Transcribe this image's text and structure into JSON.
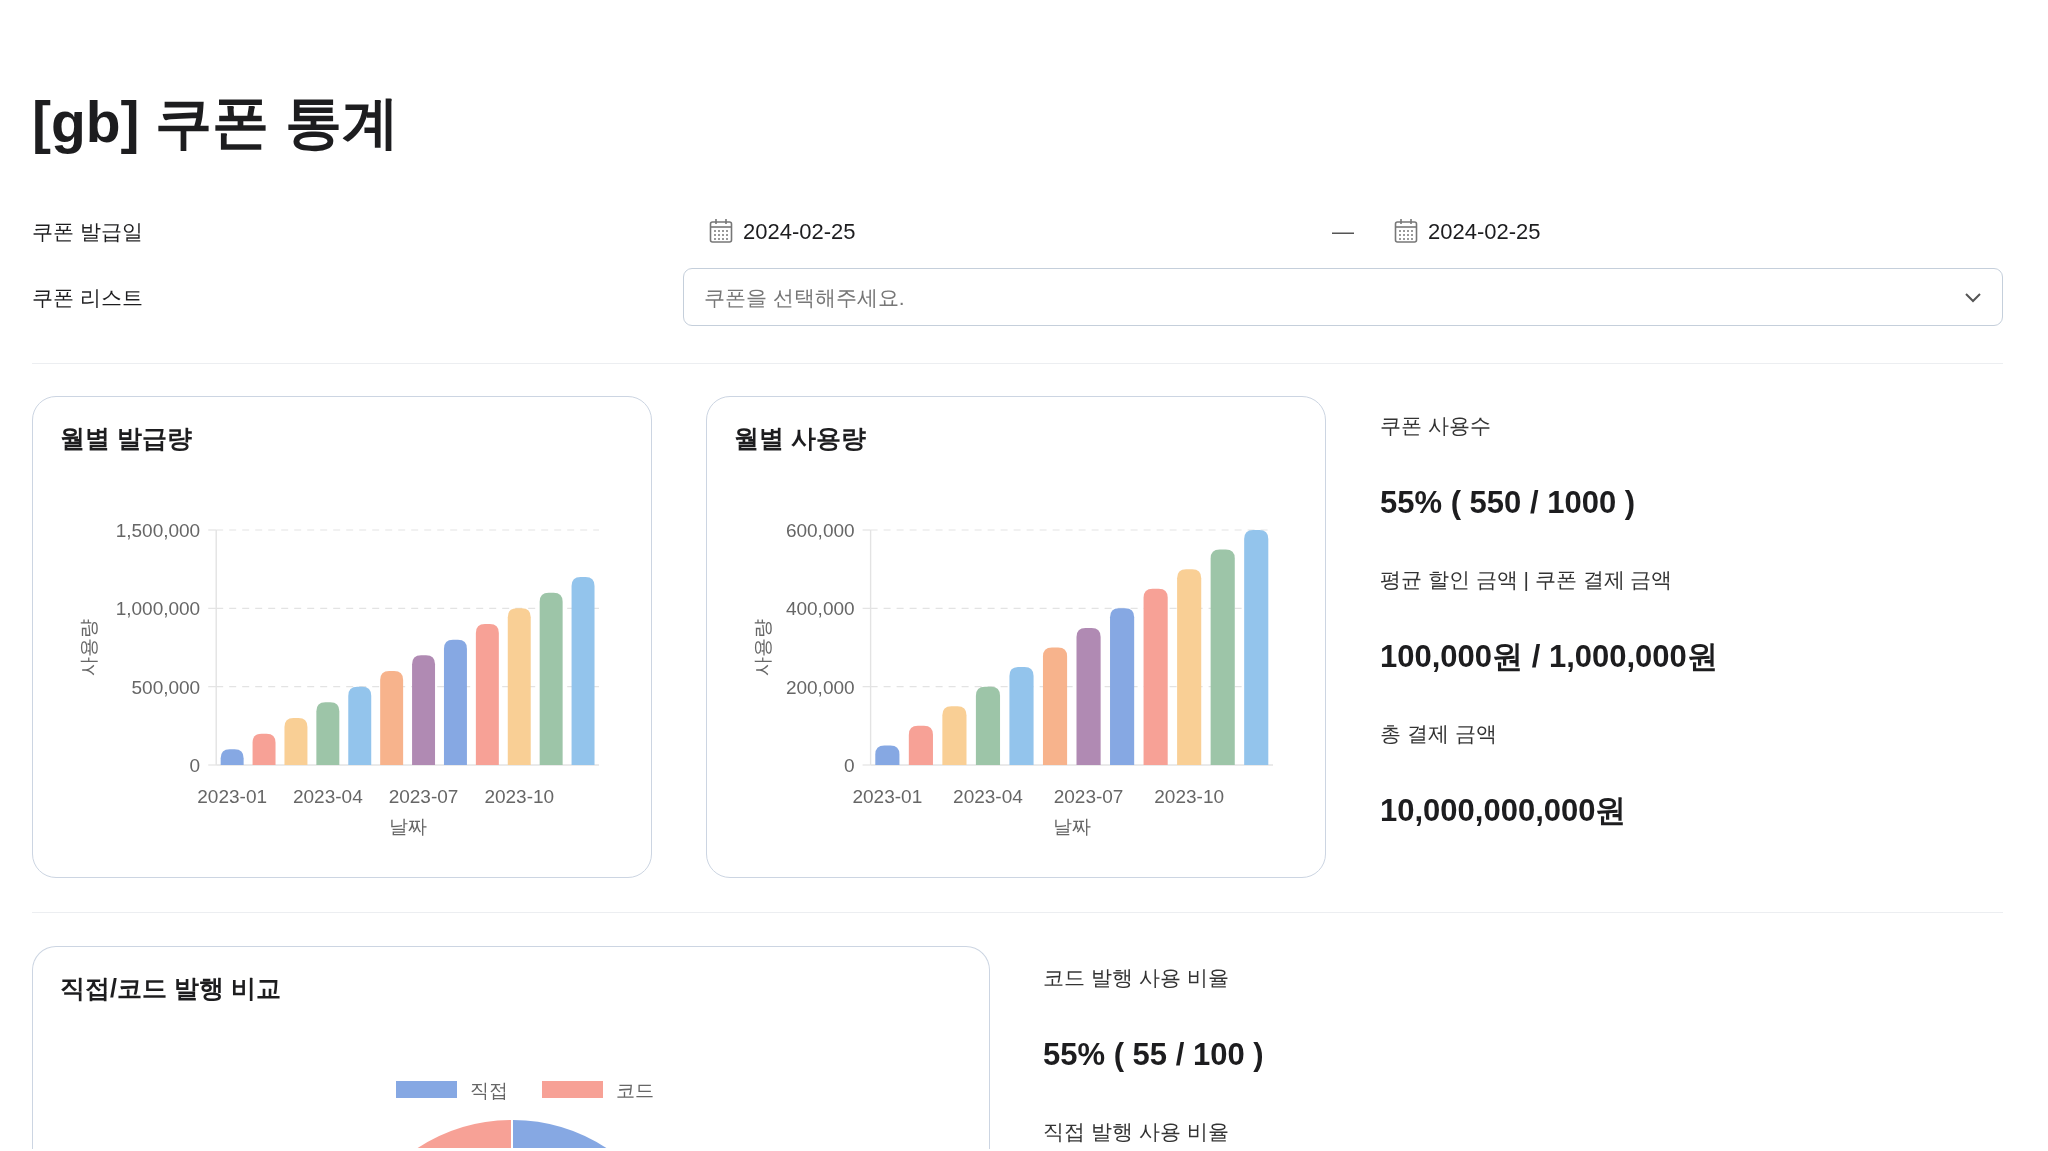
{
  "title": "[gb] 쿠폰 통계",
  "filters": [
    {
      "kind": "date_range",
      "label": "쿠폰 발급일",
      "start": "2024-02-25",
      "separator": "—",
      "end": "2024-02-25"
    },
    {
      "kind": "select",
      "label": "쿠폰 리스트",
      "placeholder": "쿠폰을 선택해주세요."
    }
  ],
  "chart_cards": [
    {
      "title": "월별 발급량",
      "chart_data": {
        "type": "bar",
        "xlabel": "날짜",
        "ylabel": "사용량",
        "categories": [
          "2023-01",
          null,
          null,
          "2023-04",
          null,
          null,
          "2023-07",
          null,
          null,
          "2023-10",
          null,
          null
        ],
        "values": [
          100000,
          200000,
          300000,
          400000,
          500000,
          600000,
          700000,
          800000,
          900000,
          1000000,
          1100000,
          1200000
        ],
        "colors": [
          "#86a8e3",
          "#f7a196",
          "#f9cf95",
          "#9dc5a8",
          "#93c4ec",
          "#f7b38c",
          "#b08ab3",
          "#86a8e3",
          "#f7a196",
          "#f9cf95",
          "#9dc5a8",
          "#93c4ec"
        ],
        "ylim": [
          0,
          1500000
        ],
        "yticks": [
          {
            "value": 0,
            "label": "0"
          },
          {
            "value": 500000,
            "label": "500,000"
          },
          {
            "value": 1000000,
            "label": "1,000,000"
          },
          {
            "value": 1500000,
            "label": "1,500,000"
          }
        ]
      }
    },
    {
      "title": "월별 사용량",
      "chart_data": {
        "type": "bar",
        "xlabel": "날짜",
        "ylabel": "사용량",
        "categories": [
          "2023-01",
          null,
          null,
          "2023-04",
          null,
          null,
          "2023-07",
          null,
          null,
          "2023-10",
          null,
          null
        ],
        "values": [
          50000,
          100000,
          150000,
          200000,
          250000,
          300000,
          350000,
          400000,
          450000,
          500000,
          550000,
          600000
        ],
        "colors": [
          "#86a8e3",
          "#f7a196",
          "#f9cf95",
          "#9dc5a8",
          "#93c4ec",
          "#f7b38c",
          "#b08ab3",
          "#86a8e3",
          "#f7a196",
          "#f9cf95",
          "#9dc5a8",
          "#93c4ec"
        ],
        "ylim": [
          0,
          600000
        ],
        "yticks": [
          {
            "value": 0,
            "label": "0"
          },
          {
            "value": 200000,
            "label": "200,000"
          },
          {
            "value": 400000,
            "label": "400,000"
          },
          {
            "value": 600000,
            "label": "600,000"
          }
        ]
      }
    }
  ],
  "stats": [
    {
      "label": "쿠폰 사용수",
      "value": "55% ( 550 / 1000 )"
    },
    {
      "label": "평균 할인 금액 | 쿠폰 결제 금액",
      "value": "100,000원 / 1,000,000원"
    },
    {
      "label": "총 결제 금액",
      "value": "10,000,000,000원"
    }
  ],
  "comparison_card": {
    "title": "직접/코드 발행 비교",
    "legend": [
      {
        "label": "직접",
        "color": "#86a8e3"
      },
      {
        "label": "코드",
        "color": "#f7a196"
      }
    ]
  },
  "ratio_stats": [
    {
      "label": "코드 발행 사용 비율",
      "value": "55% ( 55 / 100 )"
    },
    {
      "label": "직접 발행 사용 비율"
    }
  ]
}
